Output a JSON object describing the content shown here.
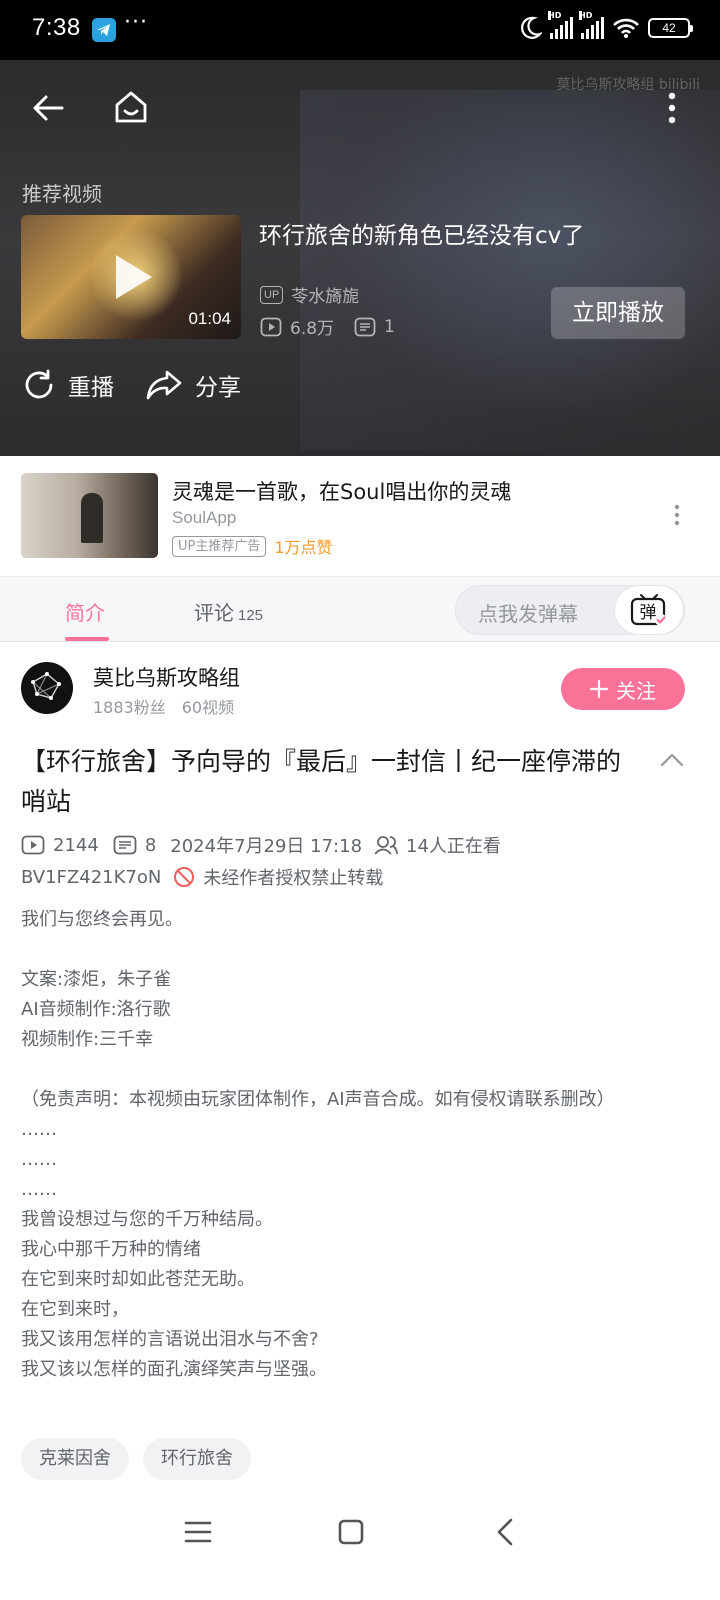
{
  "status_bar": {
    "time": "7:38",
    "dots": "···",
    "battery": "42",
    "hd1": "HD",
    "hd2": "HD"
  },
  "player": {
    "watermark": "莫比乌斯攻略组 bilibili",
    "recommend_label": "推荐视频",
    "recommended": {
      "title": "环行旅舍的新角色已经没有cv了",
      "up_badge": "UP",
      "uploader": "苓水旖旎",
      "views": "6.8万",
      "danmaku": "1",
      "duration": "01:04"
    },
    "play_now": "立即播放",
    "replay": "重播",
    "share": "分享"
  },
  "ad": {
    "title": "灵魂是一首歌，在Soul唱出你的灵魂",
    "brand": "SoulApp",
    "badge": "UP主推荐广告",
    "likes": "1万点赞"
  },
  "tabs": {
    "intro": "简介",
    "comments": "评论",
    "comments_count": "125",
    "danmu_placeholder": "点我发弹幕",
    "danmu_btn": "弹"
  },
  "uploader": {
    "name": "莫比乌斯攻略组",
    "fans": "1883粉丝",
    "videos": "60视频",
    "follow": "关注"
  },
  "video": {
    "title": "【环行旅舍】予向导的『最后』一封信丨纪一座停滞的哨站",
    "plays": "2144",
    "danmaku": "8",
    "date": "2024年7月29日 17:18",
    "watching": "14人正在看",
    "bvid": "BV1FZ421K7oN",
    "no_repost": "未经作者授权禁止转载",
    "description": [
      "我们与您终会再见。",
      "",
      "文案:漆炬，朱子雀",
      "AI音频制作:洛行歌",
      "视频制作:三千幸",
      "",
      "（免责声明：本视频由玩家团体制作，AI声音合成。如有侵权请联系删改）",
      "……",
      "……",
      "……",
      "我曾设想过与您的千万种结局。",
      "我心中那千万种的情绪",
      "在它到来时却如此苍茫无助。",
      "在它到来时，",
      "我又该用怎样的言语说出泪水与不舍?",
      "我又该以怎样的面孔演绎笑声与坚强。"
    ],
    "tags": [
      "克莱因舍",
      "环行旅舍"
    ]
  },
  "colors": {
    "accent": "#fb7299",
    "ad_like": "#f59a23",
    "text_secondary": "#61666d"
  }
}
